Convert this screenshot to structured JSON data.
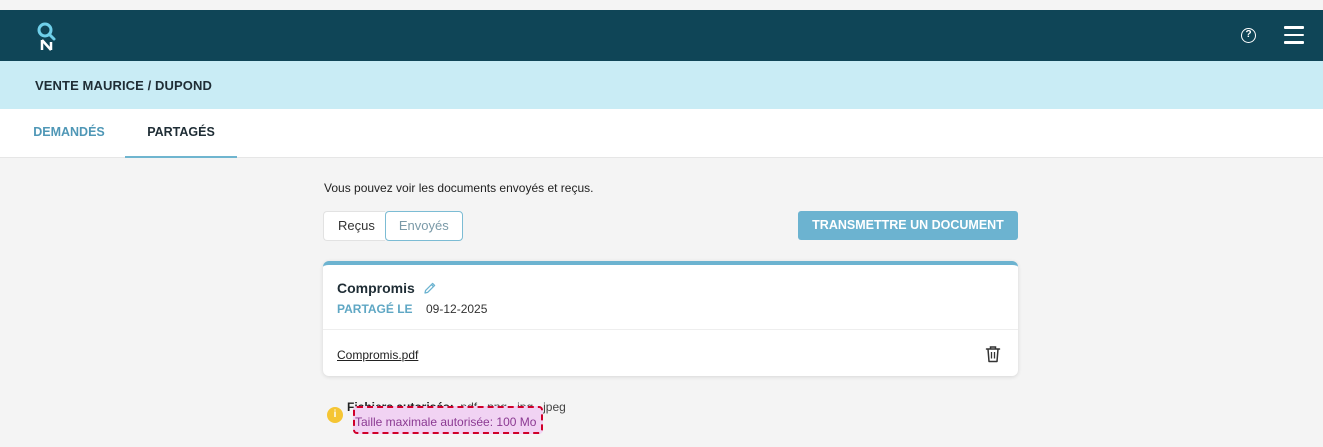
{
  "header": {
    "logo_icon": "logo-icon",
    "help_icon": "help-circle-icon",
    "help_glyph": "?",
    "menu_icon": "hamburger-menu-icon",
    "color": "#0f4557"
  },
  "case": {
    "title": "VENTE MAURICE / DUPOND",
    "color": "#c9ecf5"
  },
  "tabs": [
    {
      "label": "DEMANDÉS",
      "active": false
    },
    {
      "label": "PARTAGÉS",
      "active": true
    }
  ],
  "main": {
    "intro": "Vous pouvez voir les documents envoyés et reçus.",
    "toggle": [
      {
        "label": "Reçus",
        "selected": false
      },
      {
        "label": "Envoyés",
        "selected": true
      }
    ],
    "transmit_button": "TRANSMETTRE UN DOCUMENT",
    "accent_color": "#6cb3d0"
  },
  "document": {
    "title": "Compromis",
    "edit_icon": "pencil-icon",
    "shared_label": "PARTAGÉ LE",
    "shared_date": "09-12-2025",
    "file_name": "Compromis.pdf",
    "delete_icon": "trash-icon"
  },
  "constraints": {
    "info_icon": "info-icon",
    "info_glyph": "i",
    "allowed_label": "Fichiers autorisés:",
    "allowed_value": ".pdf, .png, .jpg, .jpeg",
    "max_size_label": "Taille maximale autorisée:",
    "max_size_value": "100 Mo",
    "highlight_color": "#d0002a"
  }
}
